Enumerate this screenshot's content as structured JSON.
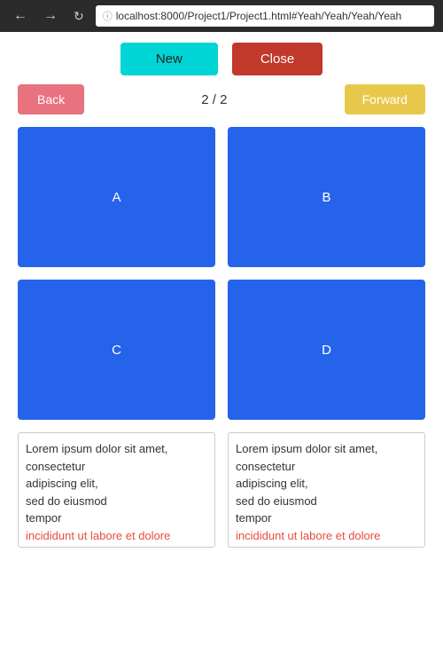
{
  "browser": {
    "url": "localhost:8000/Project1/Project1.html#Yeah/Yeah/Yeah/Yeah"
  },
  "buttons": {
    "new_label": "New",
    "close_label": "Close",
    "back_label": "Back",
    "forward_label": "Forward"
  },
  "pagination": {
    "current": 2,
    "total": 2,
    "display": "2 / 2"
  },
  "cards": [
    {
      "label": "A"
    },
    {
      "label": "B"
    },
    {
      "label": "C"
    },
    {
      "label": "D"
    }
  ],
  "textboxes": [
    {
      "text_normal": "Lorem ipsum dolor sit amet,\nconsectetur\nadipiscing elit,\nsed do eiusmod\ntempor",
      "text_highlight": "incididunt ut labore et dolore"
    },
    {
      "text_normal": "Lorem ipsum dolor sit amet,\nconsectetur\nadipiscing elit,\nsed do eiusmod\ntempor",
      "text_highlight": "incididunt ut labore et dolore"
    }
  ],
  "colors": {
    "new_bg": "#00d4d4",
    "close_bg": "#c0392b",
    "back_bg": "#e8727e",
    "forward_bg": "#e8c84a",
    "card_bg": "#2563eb"
  }
}
